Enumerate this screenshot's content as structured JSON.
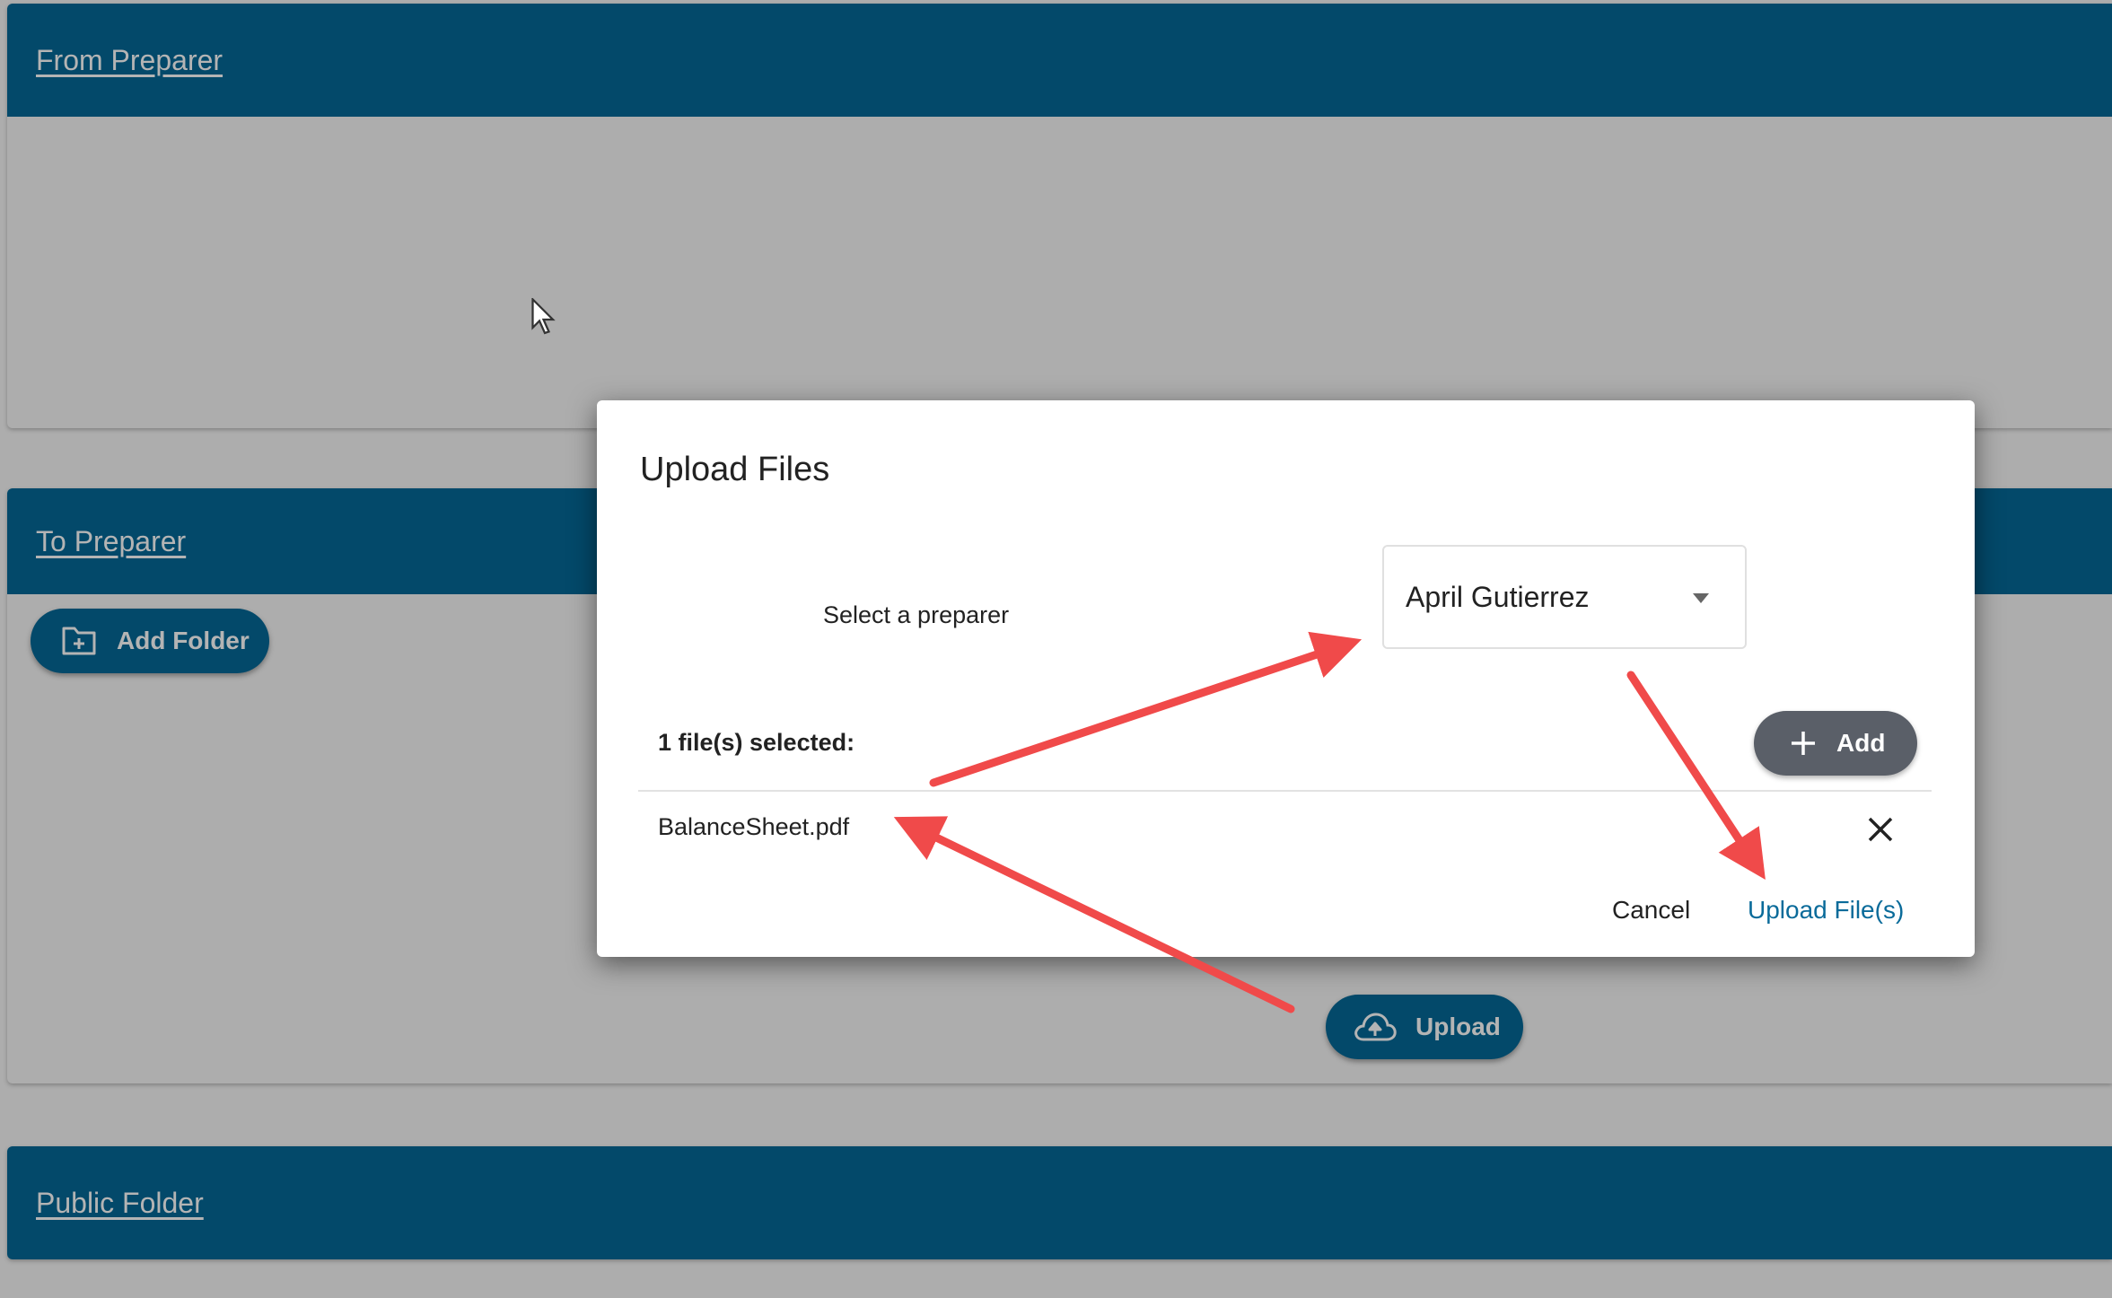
{
  "sections": {
    "from_preparer": {
      "title": "From Preparer"
    },
    "to_preparer": {
      "title": "To Preparer",
      "add_folder_label": "Add Folder",
      "upload_label": "Upload"
    },
    "public_folder": {
      "title": "Public Folder"
    }
  },
  "dialog": {
    "title": "Upload Files",
    "preparer_label": "Select a preparer",
    "preparer_selected": "April Gutierrez",
    "files_selected_label": "1 file(s) selected:",
    "add_label": "Add",
    "files": [
      {
        "name": "BalanceSheet.pdf"
      }
    ],
    "cancel_label": "Cancel",
    "upload_files_label": "Upload File(s)"
  },
  "annotations": {
    "arrow_color": "#f04a4a"
  },
  "colors": {
    "header_bg": "#03496a",
    "overlay_bg": "#adadad",
    "link_blue": "#0a6b9a",
    "add_button_bg": "#5a5f68"
  }
}
